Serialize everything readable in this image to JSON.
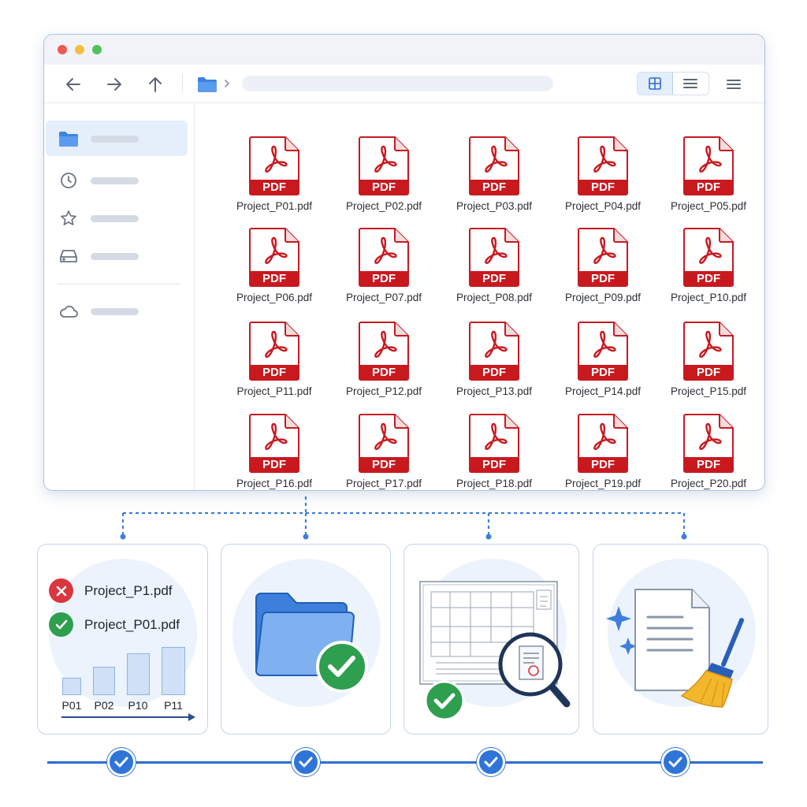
{
  "window": {
    "toolbar": {
      "back_icon": "arrow-left-icon",
      "forward_icon": "arrow-right-icon",
      "up_icon": "arrow-up-icon",
      "breadcrumb_icon": "folder-icon",
      "view_modes": [
        "grid-view-icon",
        "list-view-icon"
      ],
      "active_view": "grid",
      "menu_icon": "menu-icon"
    },
    "sidebar": {
      "items": [
        {
          "icon": "folder-icon",
          "active": true
        },
        {
          "icon": "clock-icon",
          "active": false
        },
        {
          "icon": "star-icon",
          "active": false
        },
        {
          "icon": "drive-icon",
          "active": false
        },
        {
          "icon": "cloud-icon",
          "active": false
        }
      ]
    },
    "files": {
      "badge": "PDF",
      "names": [
        "Project_P01.pdf",
        "Project_P02.pdf",
        "Project_P03.pdf",
        "Project_P04.pdf",
        "Project_P05.pdf",
        "Project_P06.pdf",
        "Project_P07.pdf",
        "Project_P08.pdf",
        "Project_P09.pdf",
        "Project_P10.pdf",
        "Project_P11.pdf",
        "Project_P12.pdf",
        "Project_P13.pdf",
        "Project_P14.pdf",
        "Project_P15.pdf",
        "Project_P16.pdf",
        "Project_P17.pdf",
        "Project_P18.pdf",
        "Project_P19.pdf",
        "Project_P20.pdf"
      ]
    }
  },
  "cards": {
    "naming": {
      "wrong_name": "Project_P1.pdf",
      "right_name": "Project_P01.pdf",
      "sort_labels": [
        "P01",
        "P02",
        "P10",
        "P11"
      ],
      "wrong_status_icon": "x-circle-icon",
      "right_status_icon": "check-circle-icon"
    },
    "organize": {
      "icon": "folder-check-icon"
    },
    "inspect": {
      "icon": "blueprint-magnifier-icon"
    },
    "cleanup": {
      "icon": "document-broom-icon"
    }
  },
  "progress": {
    "steps": 4,
    "step_icon": "check-circle-icon"
  },
  "colors": {
    "accent": "#2f74d8",
    "pdf_red": "#c8191f",
    "success": "#2e9e4f",
    "error": "#d9363e"
  }
}
